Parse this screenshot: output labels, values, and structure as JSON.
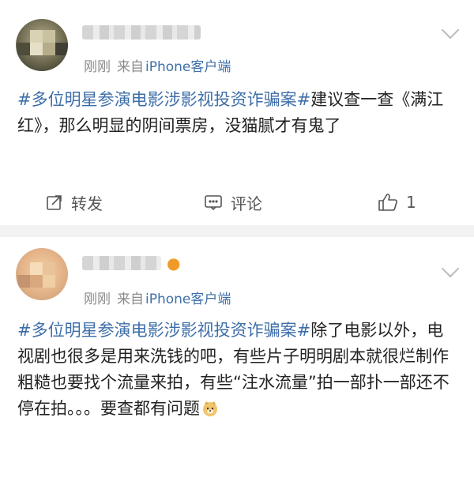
{
  "posts": [
    {
      "meta": {
        "time": "刚刚",
        "source_prefix": "来自",
        "source_app": "iPhone客户端"
      },
      "content": {
        "hashtag": "#多位明星参演电影涉影视投资诈骗案#",
        "text": "建议查一查《满江红》，那么明显的阴间票房，没猫腻才有鬼了"
      },
      "actions": {
        "forward": "转发",
        "comment": "评论",
        "like_count": "1"
      }
    },
    {
      "meta": {
        "time": "刚刚",
        "source_prefix": "来自",
        "source_app": "iPhone客户端"
      },
      "content": {
        "hashtag": "#多位明星参演电影涉影视投资诈骗案#",
        "text": "除了电影以外，电视剧也很多是用来洗钱的吧，有些片子明明剧本就很烂制作粗糙也要找个流量来拍，有些“注水流量”拍一部扑一部还不停在拍。。。要查都有问题"
      },
      "emoji": "doge-emoji"
    }
  ],
  "colors": {
    "link": "#3e6ea8",
    "meta": "#8a8a8a",
    "text": "#222222",
    "divider": "#f2f2f2"
  }
}
